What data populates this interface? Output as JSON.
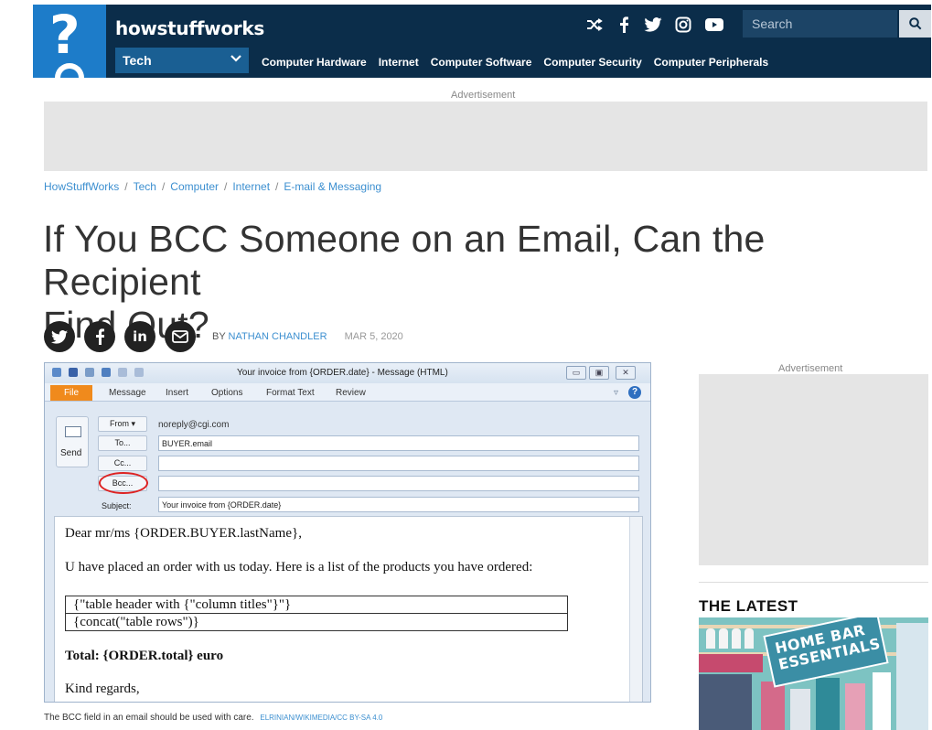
{
  "header": {
    "brand": "howstuffworks",
    "search_placeholder": "Search",
    "section": "Tech",
    "nav": [
      "Computer Hardware",
      "Internet",
      "Computer Software",
      "Computer Security",
      "Computer Peripherals"
    ],
    "icons": [
      "shuffle-icon",
      "facebook-icon",
      "twitter-icon",
      "instagram-icon",
      "youtube-icon",
      "search-icon"
    ],
    "colors": {
      "bar": "#0b2d4a",
      "logo": "#1d7cc9",
      "section": "#1a5f93"
    }
  },
  "ads": {
    "top_label": "Advertisement",
    "side_label": "Advertisement"
  },
  "breadcrumb": [
    "HowStuffWorks",
    "Tech",
    "Computer",
    "Internet",
    "E-mail & Messaging"
  ],
  "article": {
    "title_line1": "If You BCC Someone on an Email, Can the Recipient",
    "title_line2": "Find Out?",
    "by": "BY",
    "author": "NATHAN CHANDLER",
    "date": "MAR 5, 2020",
    "share_icons": [
      "twitter-icon",
      "facebook-icon",
      "linkedin-icon",
      "email-icon"
    ]
  },
  "email_window": {
    "title": "Your invoice from {ORDER.date} - Message (HTML)",
    "tabs": [
      "File",
      "Message",
      "Insert",
      "Options",
      "Format Text",
      "Review"
    ],
    "send_label": "Send",
    "from_label": "From ▾",
    "from_value": "noreply@cgi.com",
    "to_label": "To...",
    "to_value": "BUYER.email",
    "cc_label": "Cc...",
    "cc_value": "",
    "bcc_label": "Bcc...",
    "bcc_value": "",
    "subject_label": "Subject:",
    "subject_value": "Your invoice from {ORDER.date}",
    "body": {
      "greeting": "Dear mr/ms {ORDER.BUYER.lastName},",
      "intro": "U have placed an order with us today. Here is a list of the products you have ordered:",
      "table_header": "{\"table header with {\"column titles\"}\"}",
      "table_rows": "{concat(\"table rows\")}",
      "total": "Total: {ORDER.total} euro",
      "closing": "Kind regards,"
    }
  },
  "caption": {
    "text": "The BCC field in an email should be used with care.",
    "credit": "ELRINIAN/WIKIMEDIA/CC BY-SA 4.0"
  },
  "sidebar": {
    "latest_heading": "THE LATEST",
    "latest_image_text": [
      "HOME BAR",
      "ESSENTIALS"
    ]
  }
}
